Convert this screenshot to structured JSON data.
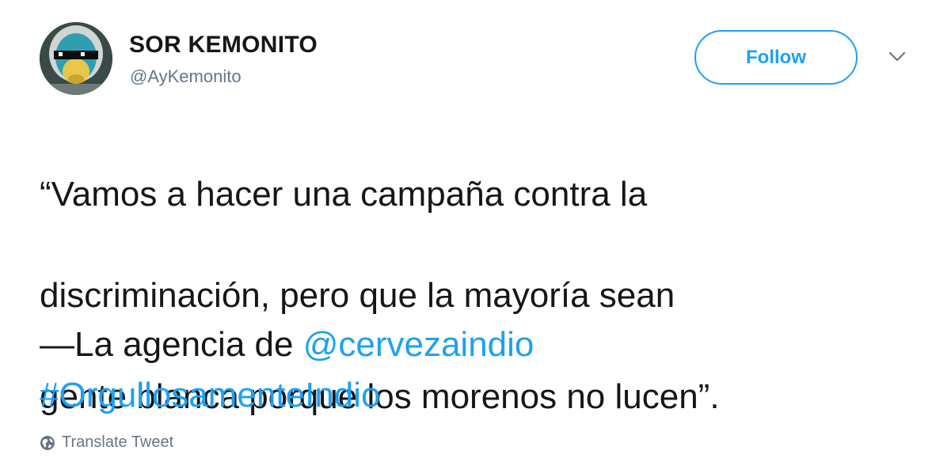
{
  "tweet": {
    "author": {
      "display_name": "SOR KEMONITO",
      "handle": "@AyKemonito",
      "avatar_icon": "avatar-monkey-sunglasses"
    },
    "follow_label": "Follow",
    "menu_icon": "chevron-down-icon",
    "text_lines": [
      "“Vamos a hacer una campaña contra la",
      "discriminación, pero que la mayoría sean",
      "gente blanca porque los morenos no lucen”."
    ],
    "signature_prefix": "—La agencia de ",
    "mention": "@cervezaindio",
    "hashtag": "#OrgullosamenteIndio",
    "translate_label": "Translate Tweet",
    "translate_icon": "globe-icon"
  },
  "colors": {
    "link_blue": "#1da1f2",
    "text_primary": "#14171a",
    "text_secondary": "#657786",
    "background": "#ffffff"
  }
}
